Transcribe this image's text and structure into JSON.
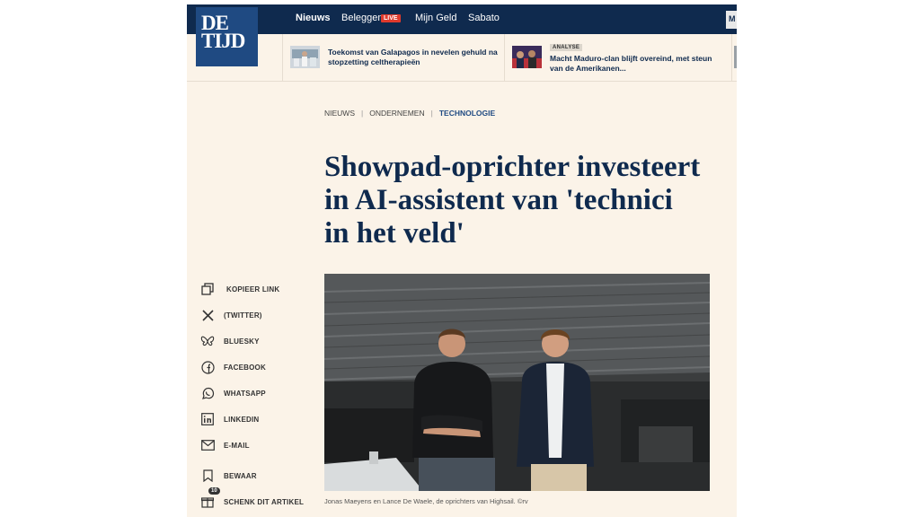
{
  "logo": {
    "line1": "DE",
    "line2": "TIJD"
  },
  "nav": {
    "items": [
      "Nieuws",
      "Beleggen",
      "Mijn Geld",
      "Sabato"
    ],
    "live_badge": "LIVE",
    "menu_label": "M"
  },
  "teasers": [
    {
      "title": "Toekomst van Galapagos in nevelen gehuld na stopzetting celtherapieën",
      "badge": ""
    },
    {
      "title": "Macht Maduro-clan blijft overeind, met steun van de Amerikanen...",
      "badge": "ANALYSE"
    }
  ],
  "breadcrumb": {
    "items": [
      "NIEUWS",
      "ONDERNEMEN",
      "TECHNOLOGIE"
    ]
  },
  "headline": "Showpad-oprichter investeert in AI-assistent van 'technici in het veld'",
  "share": {
    "items": [
      {
        "label": "KOPIEER LINK",
        "icon": "copy-icon"
      },
      {
        "label": "(TWITTER)",
        "icon": "x-icon"
      },
      {
        "label": "BLUESKY",
        "icon": "bluesky-icon"
      },
      {
        "label": "FACEBOOK",
        "icon": "facebook-icon"
      },
      {
        "label": "WHATSAPP",
        "icon": "whatsapp-icon"
      },
      {
        "label": "LINKEDIN",
        "icon": "linkedin-icon"
      },
      {
        "label": "E-MAIL",
        "icon": "mail-icon"
      },
      {
        "label": "BEWAAR",
        "icon": "bookmark-icon"
      },
      {
        "label": "SCHENK DIT ARTIKEL",
        "icon": "gift-icon"
      }
    ],
    "gift_count": "10"
  },
  "photo_caption": "Jonas Maeyens en Lance De Waele, de oprichters van Highsail. ©rv",
  "colors": {
    "nav_bg": "#0f2a4e",
    "logo_bg": "#1f4a82",
    "page_bg": "#fbf3e8",
    "live_red": "#e03a2c",
    "headline": "#0f2a4e"
  }
}
